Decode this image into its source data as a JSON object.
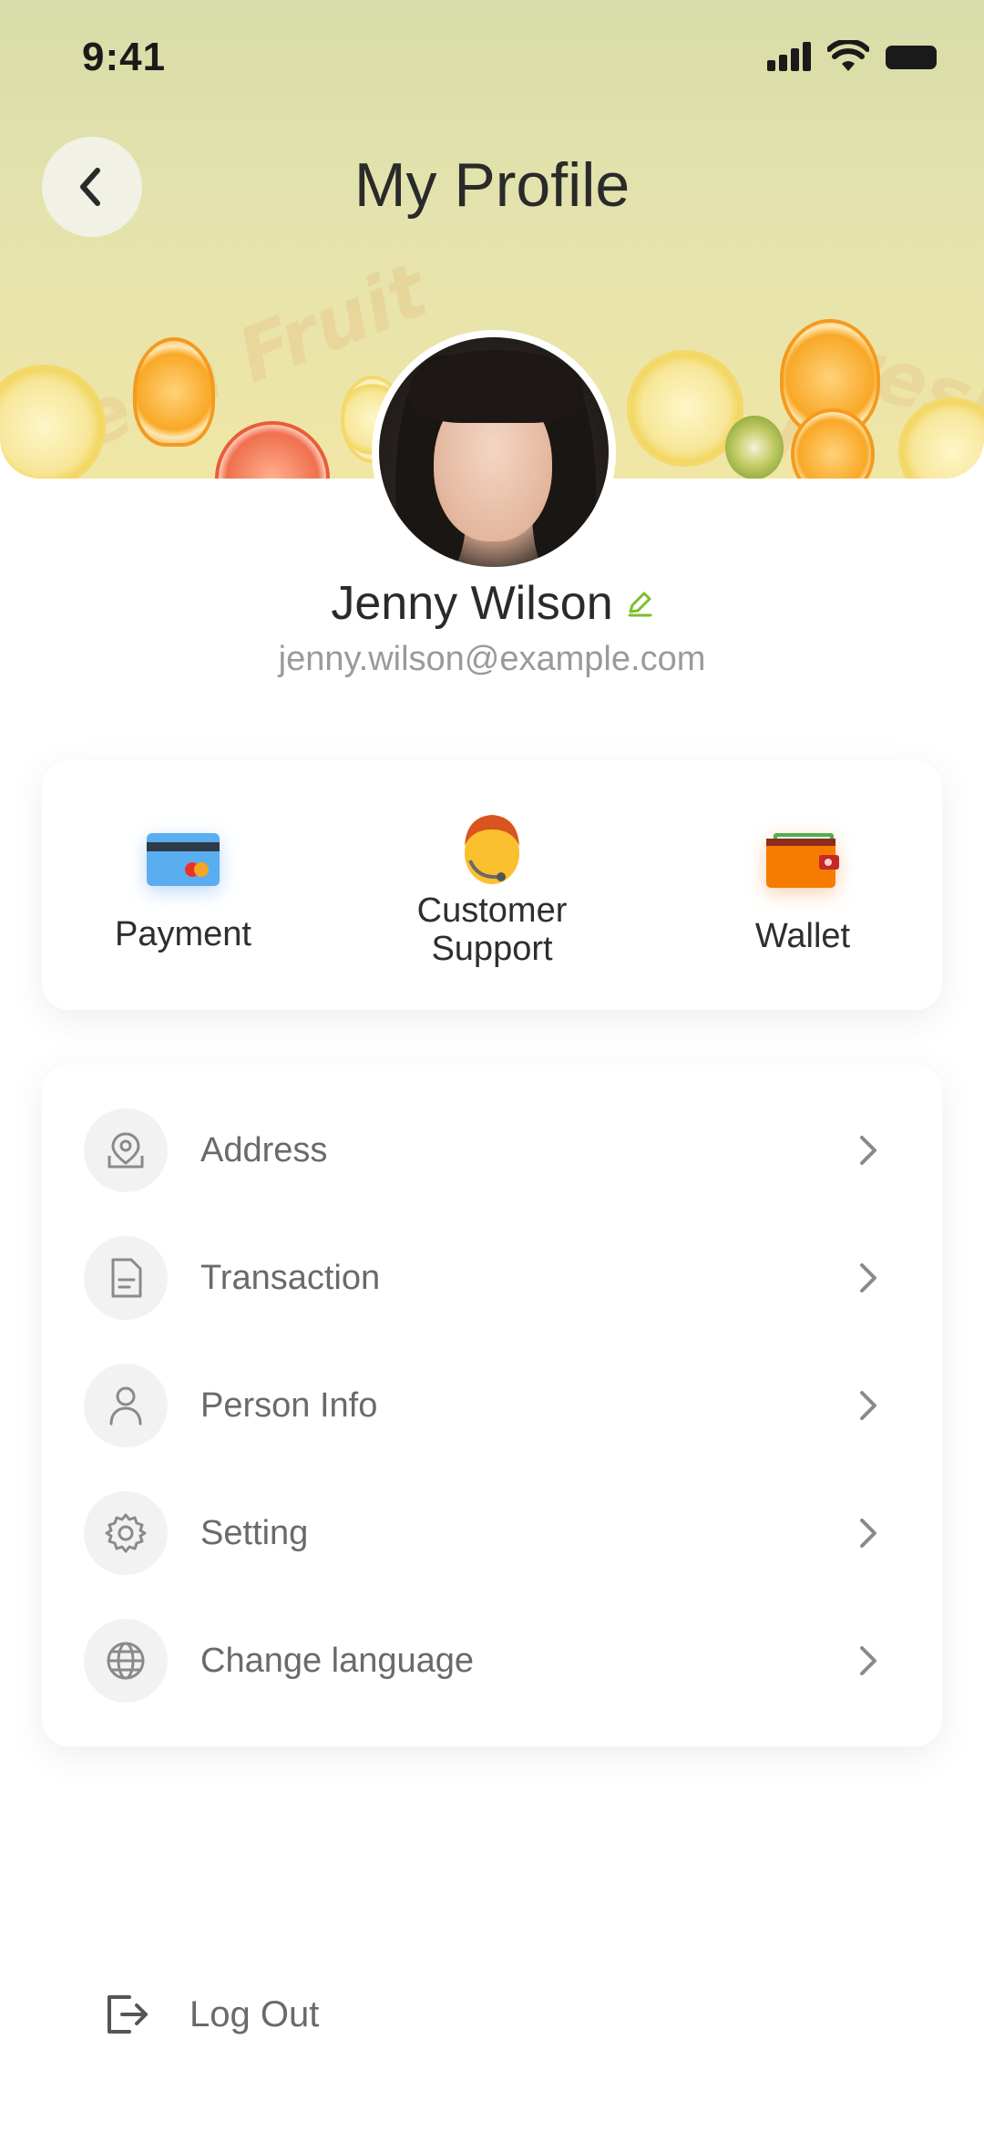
{
  "status_bar": {
    "time": "9:41"
  },
  "header": {
    "title": "My Profile",
    "watermark_left": "Fresh Fruit",
    "watermark_right": "Fresh F"
  },
  "profile": {
    "name": "Jenny Wilson",
    "email": "jenny.wilson@example.com"
  },
  "quick_actions": [
    {
      "label": "Payment",
      "icon": "credit-card-icon"
    },
    {
      "label_line1": "Customer",
      "label_line2": "Support",
      "icon": "customer-support-icon"
    },
    {
      "label": "Wallet",
      "icon": "wallet-icon"
    }
  ],
  "menu": [
    {
      "label": "Address",
      "icon": "location-pin-icon"
    },
    {
      "label": "Transaction",
      "icon": "document-icon"
    },
    {
      "label": "Person Info",
      "icon": "user-icon"
    },
    {
      "label": "Setting",
      "icon": "gear-icon"
    },
    {
      "label": "Change language",
      "icon": "globe-icon"
    }
  ],
  "logout": {
    "label": "Log Out",
    "icon": "logout-icon"
  },
  "colors": {
    "accent_green": "#7cbf2a",
    "text_dark": "#2a2a2a",
    "text_muted": "#6a6a6a",
    "email_gray": "#9a9a9a"
  }
}
